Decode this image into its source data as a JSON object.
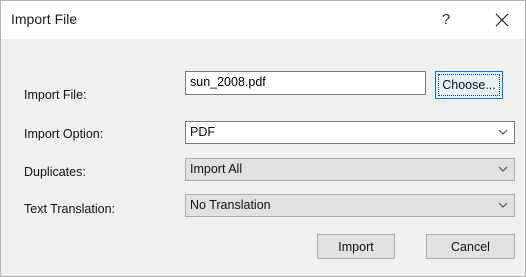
{
  "dialog": {
    "title": "Import File",
    "help": "?"
  },
  "fields": {
    "import_file_label": "Import File:",
    "import_file_value": "sun_2008.pdf",
    "choose_label": "Choose...",
    "import_option_label": "Import Option:",
    "import_option_value": "PDF",
    "duplicates_label": "Duplicates:",
    "duplicates_value": "Import All",
    "translation_label": "Text Translation:",
    "translation_value": "No Translation"
  },
  "buttons": {
    "import_label": "Import",
    "cancel_label": "Cancel"
  },
  "icons": {
    "close": "close-icon",
    "chevron": "chevron-down-icon"
  },
  "colors": {
    "focus_border": "#0078d7",
    "dialog_bg": "#f0f0f0",
    "button_bg": "#e1e1e1"
  }
}
